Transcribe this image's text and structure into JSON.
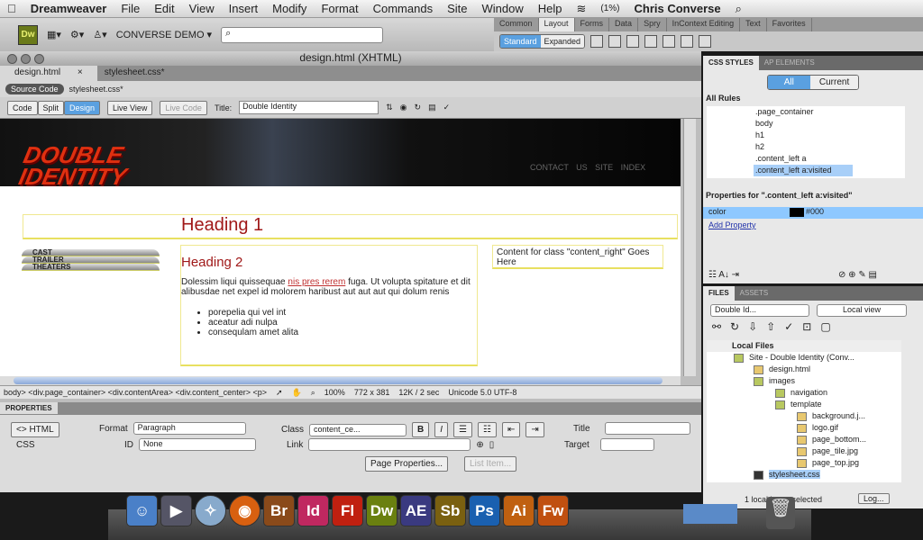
{
  "menubar": {
    "app": "Dreamweaver",
    "items": [
      "File",
      "Edit",
      "View",
      "Insert",
      "Modify",
      "Format",
      "Commands",
      "Site",
      "Window",
      "Help"
    ],
    "battery": "(1%)",
    "user": "Chris Converse"
  },
  "appbar": {
    "logo": "Dw",
    "workspace": "CONVERSE DEMO ▾",
    "search_placeholder": "⌕"
  },
  "insert": {
    "tabs": [
      "Common",
      "Layout",
      "Forms",
      "Data",
      "Spry",
      "InContext Editing",
      "Text",
      "Favorites"
    ],
    "active": "Layout",
    "modes": [
      "Standard",
      "Expanded"
    ]
  },
  "doc": {
    "title": "design.html (XHTML)",
    "tabs": [
      "design.html",
      "stylesheet.css*"
    ],
    "related": [
      "Source Code",
      "stylesheet.css*"
    ],
    "views": [
      "Code",
      "Split",
      "Design"
    ],
    "live_view": "Live View",
    "live_code": "Live Code",
    "title_label": "Title:",
    "title_value": "Double Identity"
  },
  "page": {
    "logo": "DOUBLE IDENTITY",
    "links": "CONTACT US   SITE INDEX",
    "h1": "Heading 1",
    "nav": [
      "CAST",
      "TRAILER",
      "THEATERS"
    ],
    "h2": "Heading 2",
    "p_before": "Dolessim liqui quissequae ",
    "p_link": "nis pres rerem",
    "p_after": " fuga. Ut volupta spitature et dit alibusdae net expel id molorem haribust aut aut aut qui dolum renis",
    "list": [
      "porepelia qui vel int",
      "aceatur adi nulpa",
      "consequlam amet alita"
    ],
    "right": "Content for class \"content_right\" Goes Here"
  },
  "status": {
    "tags": "body> <div.page_container> <div.contentArea> <div.content_center> <p>",
    "zoom": "100%",
    "size": "772 x 381",
    "dl": "12K / 2 sec",
    "enc": "Unicode 5.0 UTF-8"
  },
  "props": {
    "header": "PROPERTIES",
    "html": "<> HTML",
    "css": "CSS",
    "format_label": "Format",
    "format": "Paragraph",
    "id_label": "ID",
    "id": "None",
    "class_label": "Class",
    "class": "content_ce...",
    "link_label": "Link",
    "title_label": "Title",
    "target_label": "Target",
    "bold": "B",
    "italic": "I",
    "page_props": "Page Properties...",
    "list_item": "List Item..."
  },
  "css": {
    "tabs": [
      "CSS STYLES",
      "AP ELEMENTS"
    ],
    "modes": [
      "All",
      "Current"
    ],
    "all_rules": "All Rules",
    "rules": [
      ".page_container",
      "body",
      "h1",
      "h2",
      ".content_left a",
      ".content_left a:visited"
    ],
    "props_for": "Properties for \".content_left a:visited\"",
    "prop_name": "color",
    "prop_value": "#000",
    "add": "Add Property"
  },
  "files": {
    "tabs": [
      "FILES",
      "ASSETS"
    ],
    "site": "Double Id...",
    "view": "Local view",
    "local_files": "Local Files",
    "tree": [
      "Site - Double Identity (Conv...",
      "design.html",
      "images",
      "navigation",
      "template",
      "background.j...",
      "logo.gif",
      "page_bottom...",
      "page_tile.jpg",
      "page_top.jpg",
      "stylesheet.css"
    ],
    "status": "1 local items selected",
    "log": "Log..."
  },
  "dock": {
    "apps": [
      "Br",
      "Id",
      "Fl",
      "Dw",
      "AE",
      "Sb",
      "Ps",
      "Ai",
      "Fw"
    ],
    "colors": [
      "#8a4a1a",
      "#c02860",
      "#c02010",
      "#6a8010",
      "#3a3a80",
      "#7a6010",
      "#1a60b0",
      "#c06010",
      "#c05010"
    ]
  }
}
